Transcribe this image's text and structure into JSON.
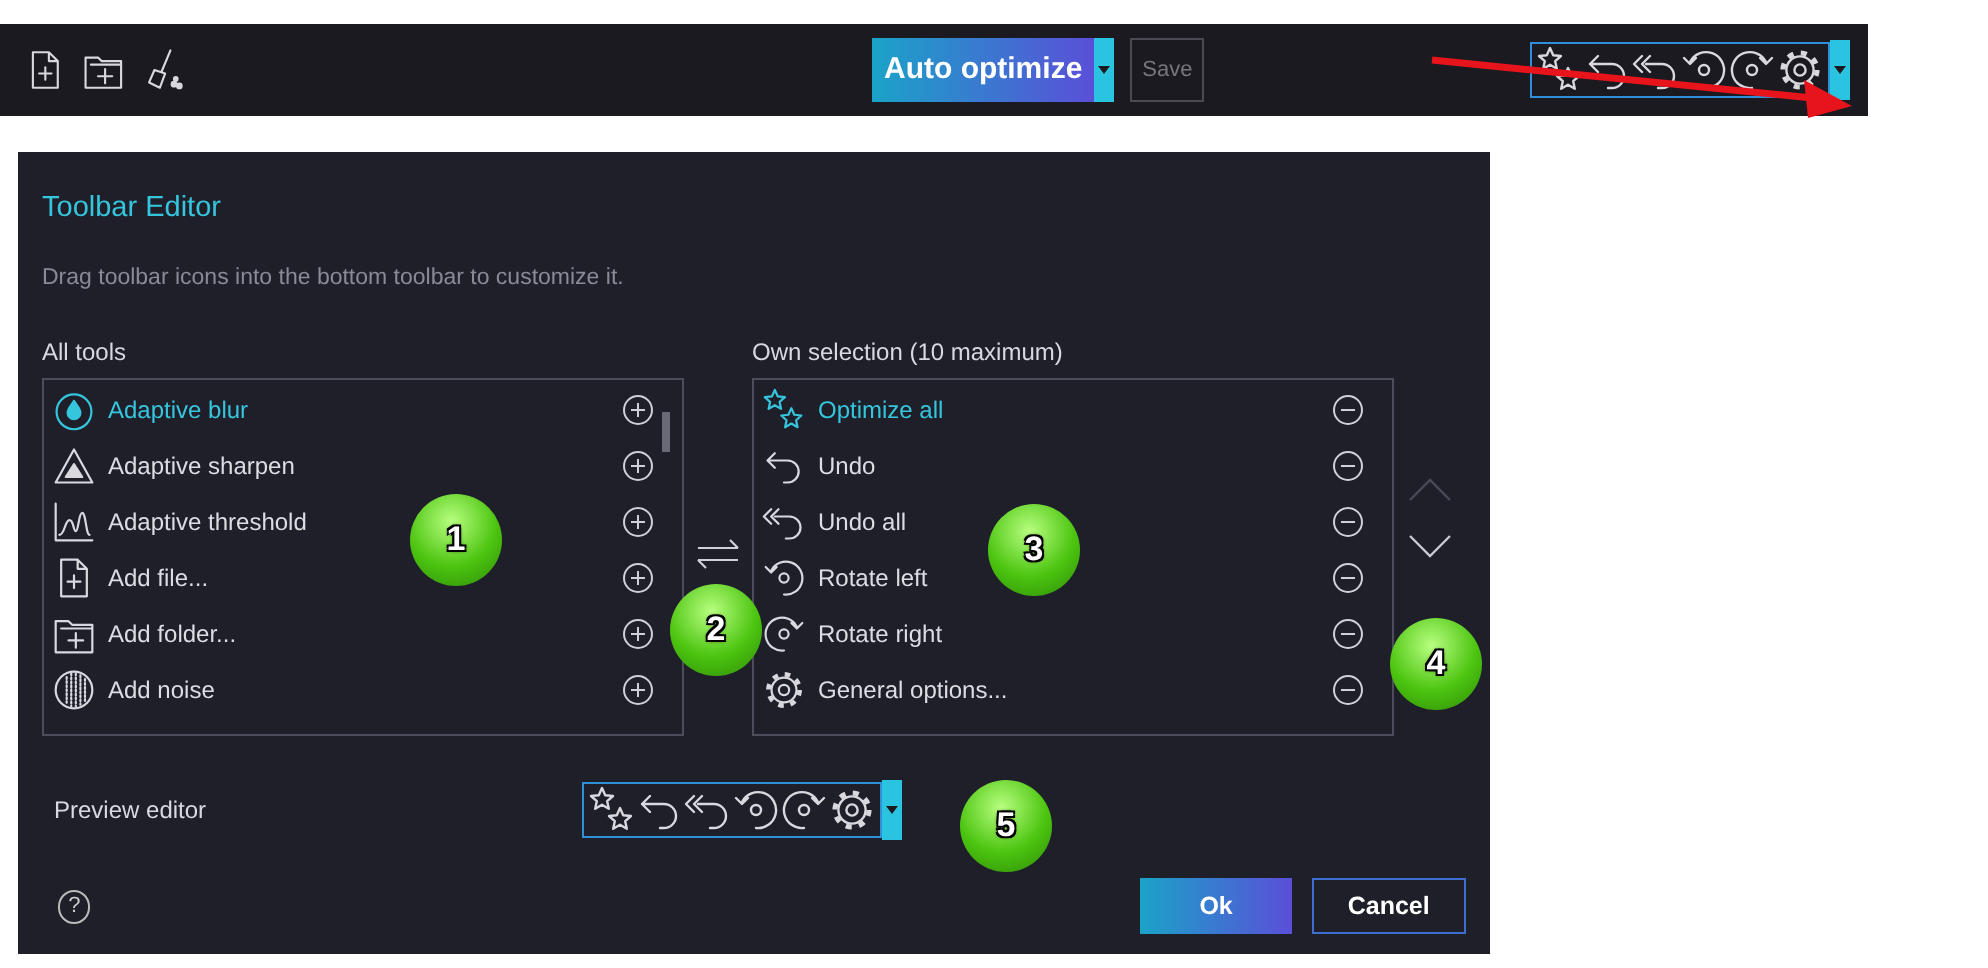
{
  "top_toolbar": {
    "left_tools": [
      {
        "kind": "add-file"
      },
      {
        "kind": "add-folder"
      },
      {
        "kind": "broom"
      }
    ],
    "main_button": "Auto optimize",
    "save_button": {
      "label": "Save",
      "disabled": true
    }
  },
  "dialog": {
    "title": "Toolbar Editor",
    "description": "Drag toolbar icons into the bottom toolbar to customize it.",
    "all_tools": {
      "label": "All tools",
      "items": [
        {
          "label": "Adaptive blur",
          "kind": "blur",
          "selected": true
        },
        {
          "label": "Adaptive sharpen",
          "kind": "sharpen",
          "selected": false
        },
        {
          "label": "Adaptive threshold",
          "kind": "threshold",
          "selected": false
        },
        {
          "label": "Add file...",
          "kind": "add-file",
          "selected": false
        },
        {
          "label": "Add folder...",
          "kind": "add-folder",
          "selected": false
        },
        {
          "label": "Add noise",
          "kind": "noise",
          "selected": false
        }
      ]
    },
    "own_selection": {
      "label": "Own selection (10 maximum)",
      "items": [
        {
          "label": "Optimize all",
          "kind": "stars",
          "selected": true
        },
        {
          "label": "Undo",
          "kind": "undo",
          "selected": false
        },
        {
          "label": "Undo all",
          "kind": "undo-all",
          "selected": false
        },
        {
          "label": "Rotate left",
          "kind": "rotate-left",
          "selected": false
        },
        {
          "label": "Rotate right",
          "kind": "rotate-right",
          "selected": false
        },
        {
          "label": "General options...",
          "kind": "gear",
          "selected": false
        }
      ]
    },
    "move_buttons": [
      {
        "kind": "up",
        "disabled": true
      },
      {
        "kind": "down",
        "disabled": false
      }
    ],
    "preview_label": "Preview editor",
    "help": "?",
    "ok_button": "Ok",
    "cancel_button": "Cancel"
  },
  "callouts": [
    {
      "label": "1"
    },
    {
      "label": "2"
    },
    {
      "label": "3"
    },
    {
      "label": "4"
    },
    {
      "label": "5"
    }
  ]
}
